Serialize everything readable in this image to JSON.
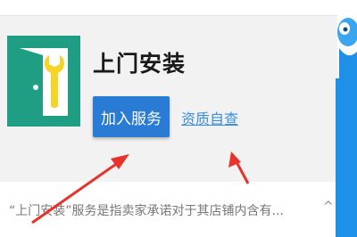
{
  "service": {
    "title": "上门安装",
    "join_label": "加入服务",
    "qualification_link": "资质自查",
    "description": "“上门安装”服务是指卖家承诺对于其店铺内含有...",
    "collapse_symbol": "^"
  },
  "colors": {
    "logo_bg": "#1f9e84",
    "button_bg": "#2a7bd4",
    "link": "#3a8ee6",
    "arrow": "#e8332b",
    "side_bar": "#1e90e8"
  },
  "icons": {
    "logo": "door-wrench-icon",
    "mascot": "mascot-icon",
    "collapse": "chevron-up-icon"
  }
}
